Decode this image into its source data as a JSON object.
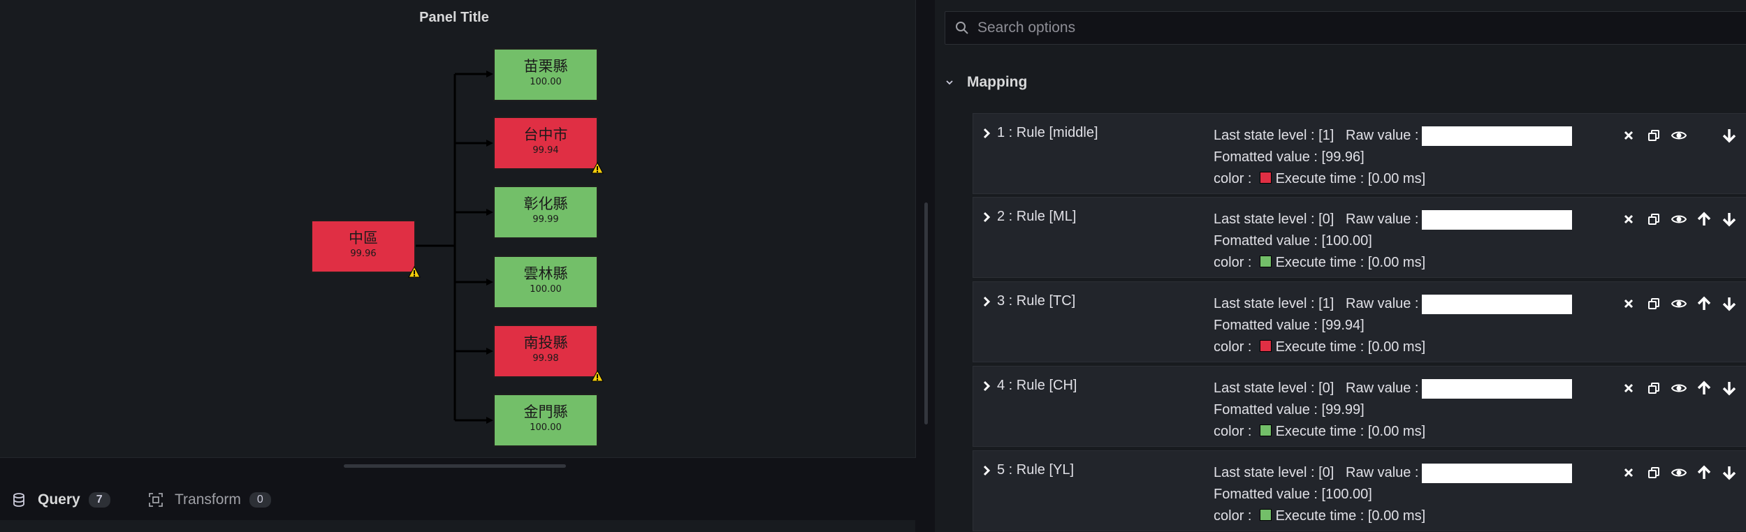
{
  "panel": {
    "title": "Panel Title",
    "root": {
      "name": "中區",
      "value": "99.96",
      "status": "red",
      "warning": true
    },
    "children": [
      {
        "name": "苗栗縣",
        "value": "100.00",
        "status": "green",
        "warning": false
      },
      {
        "name": "台中市",
        "value": "99.94",
        "status": "red",
        "warning": true
      },
      {
        "name": "彰化縣",
        "value": "99.99",
        "status": "green",
        "warning": false
      },
      {
        "name": "雲林縣",
        "value": "100.00",
        "status": "green",
        "warning": false
      },
      {
        "name": "南投縣",
        "value": "99.98",
        "status": "red",
        "warning": true
      },
      {
        "name": "金門縣",
        "value": "100.00",
        "status": "green",
        "warning": false
      }
    ]
  },
  "tabs": {
    "query": {
      "label": "Query",
      "count": "7"
    },
    "transform": {
      "label": "Transform",
      "count": "0"
    }
  },
  "options": {
    "search_placeholder": "Search options",
    "section_title": "Mapping",
    "rules": [
      {
        "title": "1 : Rule [middle]",
        "state": "Last state level : [1]",
        "raw_label": "Raw value :",
        "formatted": "Fomatted value : [99.96]",
        "color_label": "color :",
        "color": "#e02f44",
        "execute": "Execute time : [0.00 ms]"
      },
      {
        "title": "2 : Rule [ML]",
        "state": "Last state level : [0]",
        "raw_label": "Raw value :",
        "formatted": "Fomatted value : [100.00]",
        "color_label": "color :",
        "color": "#73bf69",
        "execute": "Execute time : [0.00 ms]"
      },
      {
        "title": "3 : Rule [TC]",
        "state": "Last state level : [1]",
        "raw_label": "Raw value :",
        "formatted": "Fomatted value : [99.94]",
        "color_label": "color :",
        "color": "#e02f44",
        "execute": "Execute time : [0.00 ms]"
      },
      {
        "title": "4 : Rule [CH]",
        "state": "Last state level : [0]",
        "raw_label": "Raw value :",
        "formatted": "Fomatted value : [99.99]",
        "color_label": "color :",
        "color": "#73bf69",
        "execute": "Execute time : [0.00 ms]"
      },
      {
        "title": "5 : Rule [YL]",
        "state": "Last state level : [0]",
        "raw_label": "Raw value :",
        "formatted": "Fomatted value : [100.00]",
        "color_label": "color :",
        "color": "#73bf69",
        "execute": "Execute time : [0.00 ms]"
      }
    ]
  },
  "colors": {
    "green": "#73bf69",
    "red": "#e02f44",
    "accent": "#f05a28"
  }
}
